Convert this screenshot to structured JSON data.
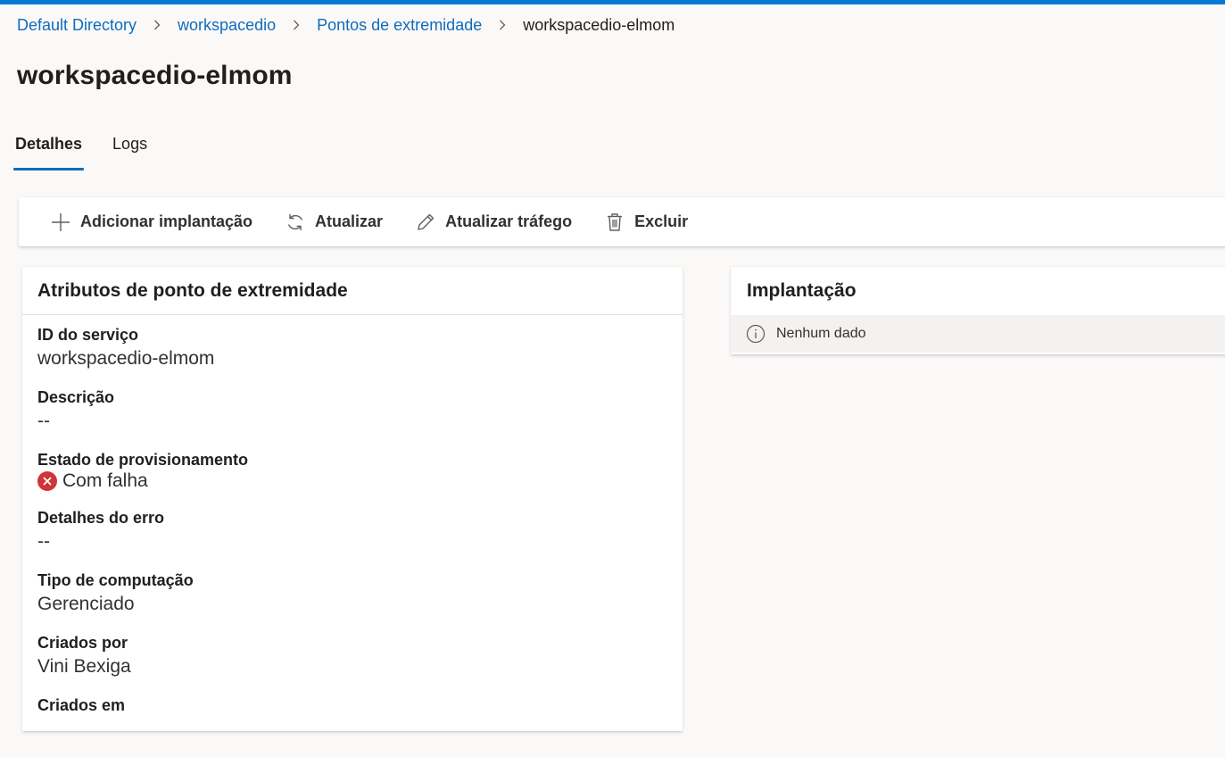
{
  "accent_color": "#0078d4",
  "breadcrumb": {
    "items": [
      {
        "label": "Default Directory"
      },
      {
        "label": "workspacedio"
      },
      {
        "label": "Pontos de extremidade"
      }
    ],
    "current": "workspacedio-elmom"
  },
  "page_title": "workspacedio-elmom",
  "tabs": [
    {
      "label": "Detalhes",
      "active": true
    },
    {
      "label": "Logs",
      "active": false
    }
  ],
  "toolbar": {
    "add_label": "Adicionar implantação",
    "refresh_label": "Atualizar",
    "update_traffic_label": "Atualizar tráfego",
    "delete_label": "Excluir"
  },
  "attributes_card": {
    "title": "Atributos de ponto de extremidade",
    "items": [
      {
        "label": "ID do serviço",
        "value": "workspacedio-elmom"
      },
      {
        "label": "Descrição",
        "value": "--"
      },
      {
        "label": "Estado de provisionamento",
        "value": "Com falha",
        "status_icon": "error-circle-icon",
        "status_color": "#d13438"
      },
      {
        "label": "Detalhes do erro",
        "value": "--"
      },
      {
        "label": "Tipo de computação",
        "value": "Gerenciado"
      },
      {
        "label": "Criados por",
        "value": "Vini Bexiga"
      },
      {
        "label": "Criados em",
        "value": ""
      }
    ]
  },
  "deployment_card": {
    "title": "Implantação",
    "empty_message": "Nenhum dado",
    "info_icon": "info-icon"
  }
}
